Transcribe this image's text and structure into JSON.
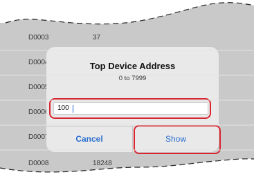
{
  "list": {
    "rows": [
      {
        "address": "D0003",
        "value": "37"
      },
      {
        "address": "D0004",
        "value": ""
      },
      {
        "address": "D0005",
        "value": ""
      },
      {
        "address": "D0006",
        "value": ""
      },
      {
        "address": "D0007",
        "value": ""
      },
      {
        "address": "D0008",
        "value": "18248"
      }
    ]
  },
  "dialog": {
    "title": "Top Device Address",
    "subtitle": "0 to 7999",
    "input_value": "100",
    "cancel_label": "Cancel",
    "show_label": "Show"
  },
  "colors": {
    "accent": "#2a6fce",
    "highlight": "#d9252f",
    "dialog_bg": "#e9e9e9"
  }
}
